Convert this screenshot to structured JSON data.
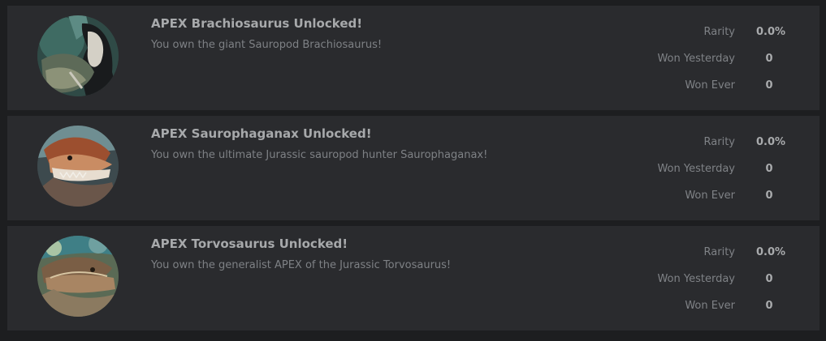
{
  "achievements": [
    {
      "title": "APEX Brachiosaurus Unlocked!",
      "description": "You own the giant Sauropod Brachiosaurus!",
      "icon": "brachiosaurus-portrait",
      "stats": {
        "rarity_label": "Rarity",
        "rarity_value": "0.0%",
        "won_yesterday_label": "Won Yesterday",
        "won_yesterday_value": "0",
        "won_ever_label": "Won Ever",
        "won_ever_value": "0"
      }
    },
    {
      "title": "APEX Saurophaganax Unlocked!",
      "description": "You own the ultimate Jurassic sauropod hunter Saurophaganax!",
      "icon": "saurophaganax-portrait",
      "stats": {
        "rarity_label": "Rarity",
        "rarity_value": "0.0%",
        "won_yesterday_label": "Won Yesterday",
        "won_yesterday_value": "0",
        "won_ever_label": "Won Ever",
        "won_ever_value": "0"
      }
    },
    {
      "title": "APEX Torvosaurus Unlocked!",
      "description": "You own the generalist APEX of the Jurassic Torvosaurus!",
      "icon": "torvosaurus-portrait",
      "stats": {
        "rarity_label": "Rarity",
        "rarity_value": "0.0%",
        "won_yesterday_label": "Won Yesterday",
        "won_yesterday_value": "0",
        "won_ever_label": "Won Ever",
        "won_ever_value": "0"
      }
    }
  ],
  "colors": {
    "page_background": "#1d1e20",
    "card_background": "#2a2b2e",
    "title_text": "#a7a9ab",
    "description_text": "#7e8185",
    "stat_value_text": "#a9abad"
  }
}
